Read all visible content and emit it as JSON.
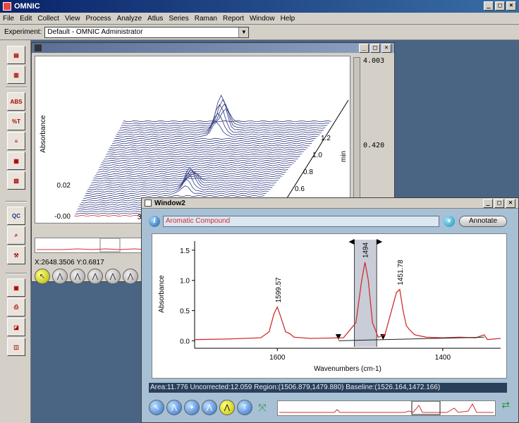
{
  "app": {
    "title": "OMNIC"
  },
  "window_buttons": [
    "_",
    "□",
    "×"
  ],
  "menu": [
    "File",
    "Edit",
    "Collect",
    "View",
    "Process",
    "Analyze",
    "Atlus",
    "Series",
    "Raman",
    "Report",
    "Window",
    "Help"
  ],
  "experiment": {
    "label": "Experiment:",
    "value": "Default - OMNIC Administrator"
  },
  "left_toolbar": [
    "ABS",
    "%T",
    "QC"
  ],
  "win1": {
    "ylabel": "Absorbance",
    "yticks": [
      "0.02",
      "-0.00"
    ],
    "zlabel": "min",
    "zticks": [
      "1.2",
      "1.0",
      "0.8",
      "0.6"
    ],
    "xtick_partial": "30",
    "side_values": [
      "4.003",
      "0.420"
    ],
    "coords": "X:2648.3506  Y:0.6817"
  },
  "win2": {
    "title": "Window2",
    "annotation": "Aromatic Compound",
    "annotate_button": "Annotate",
    "status": "Area:11.776 Uncorrected:12.059 Region:(1506.879,1479.880) Baseline:(1526.164,1472.166)",
    "chart_data": {
      "type": "line",
      "xlabel": "Wavenumbers (cm-1)",
      "ylabel": "Absorbance",
      "x_reversed": true,
      "xlim": [
        1700,
        1330
      ],
      "ylim": [
        -0.1,
        1.65
      ],
      "yticks": [
        0.0,
        0.5,
        1.0,
        1.5
      ],
      "ytick_labels": [
        "0.0",
        "0.5",
        "1.0",
        "1.5"
      ],
      "xticks": [
        1600,
        1400
      ],
      "xtick_labels": [
        "1600",
        "1400"
      ],
      "series": [
        {
          "color": "#d03030",
          "points": [
            [
              1700,
              0.02
            ],
            [
              1660,
              0.03
            ],
            [
              1620,
              0.05
            ],
            [
              1610,
              0.15
            ],
            [
              1604,
              0.45
            ],
            [
              1600,
              0.56
            ],
            [
              1596,
              0.4
            ],
            [
              1590,
              0.15
            ],
            [
              1585,
              0.12
            ],
            [
              1580,
              0.06
            ],
            [
              1560,
              0.04
            ],
            [
              1520,
              0.05
            ],
            [
              1505,
              0.3
            ],
            [
              1498,
              1.0
            ],
            [
              1494,
              1.3
            ],
            [
              1490,
              1.0
            ],
            [
              1485,
              0.3
            ],
            [
              1478,
              0.06
            ],
            [
              1470,
              0.1
            ],
            [
              1462,
              0.5
            ],
            [
              1456,
              0.8
            ],
            [
              1452,
              0.85
            ],
            [
              1448,
              0.5
            ],
            [
              1444,
              0.25
            ],
            [
              1440,
              0.18
            ],
            [
              1434,
              0.1
            ],
            [
              1420,
              0.06
            ],
            [
              1400,
              0.05
            ],
            [
              1380,
              0.06
            ],
            [
              1360,
              0.05
            ],
            [
              1350,
              0.1
            ],
            [
              1346,
              0.02
            ],
            [
              1330,
              0.04
            ]
          ]
        },
        {
          "color": "#202020",
          "points": [
            [
              1526,
              0.0
            ],
            [
              1472,
              0.02
            ],
            [
              1440,
              0.03
            ],
            [
              1350,
              0.06
            ]
          ]
        }
      ],
      "peak_labels": [
        {
          "x": 1599.57,
          "y": 0.56,
          "label": "1599.57"
        },
        {
          "x": 1494,
          "y": 1.3,
          "label": "1494"
        },
        {
          "x": 1451.78,
          "y": 0.85,
          "label": "1451.78"
        }
      ],
      "region": [
        1506.879,
        1479.88
      ],
      "baseline": [
        1526.164,
        1472.166
      ]
    }
  }
}
